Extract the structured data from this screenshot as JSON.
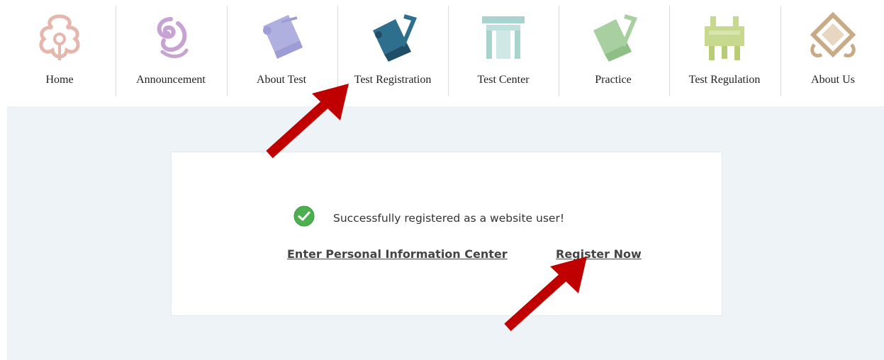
{
  "nav": {
    "items": [
      {
        "label": "Home",
        "icon": "cloud-ornament-icon",
        "color": "#e8b8b0"
      },
      {
        "label": "Announcement",
        "icon": "swirl-icon",
        "color": "#c6a3d2"
      },
      {
        "label": "About Test",
        "icon": "scroll-icon",
        "color": "#a9a9dc"
      },
      {
        "label": "Test Registration",
        "icon": "scroll-brush-icon",
        "color": "#2e6f8e"
      },
      {
        "label": "Test Center",
        "icon": "gate-icon",
        "color": "#a9d3cf"
      },
      {
        "label": "Practice",
        "icon": "scroll-brush-icon",
        "color": "#a7cf9f"
      },
      {
        "label": "Test Regulation",
        "icon": "bronze-vessel-icon",
        "color": "#c7d98e"
      },
      {
        "label": "About Us",
        "icon": "diamond-knot-icon",
        "color": "#c9aa86"
      }
    ]
  },
  "message": {
    "success": "Successfully registered as a website user!",
    "enter_link": "Enter Personal Information Center",
    "register_link": "Register Now"
  },
  "colors": {
    "panel_bg": "#eef3f7",
    "arrow": "#c00000",
    "check_green": "#4caf50"
  }
}
